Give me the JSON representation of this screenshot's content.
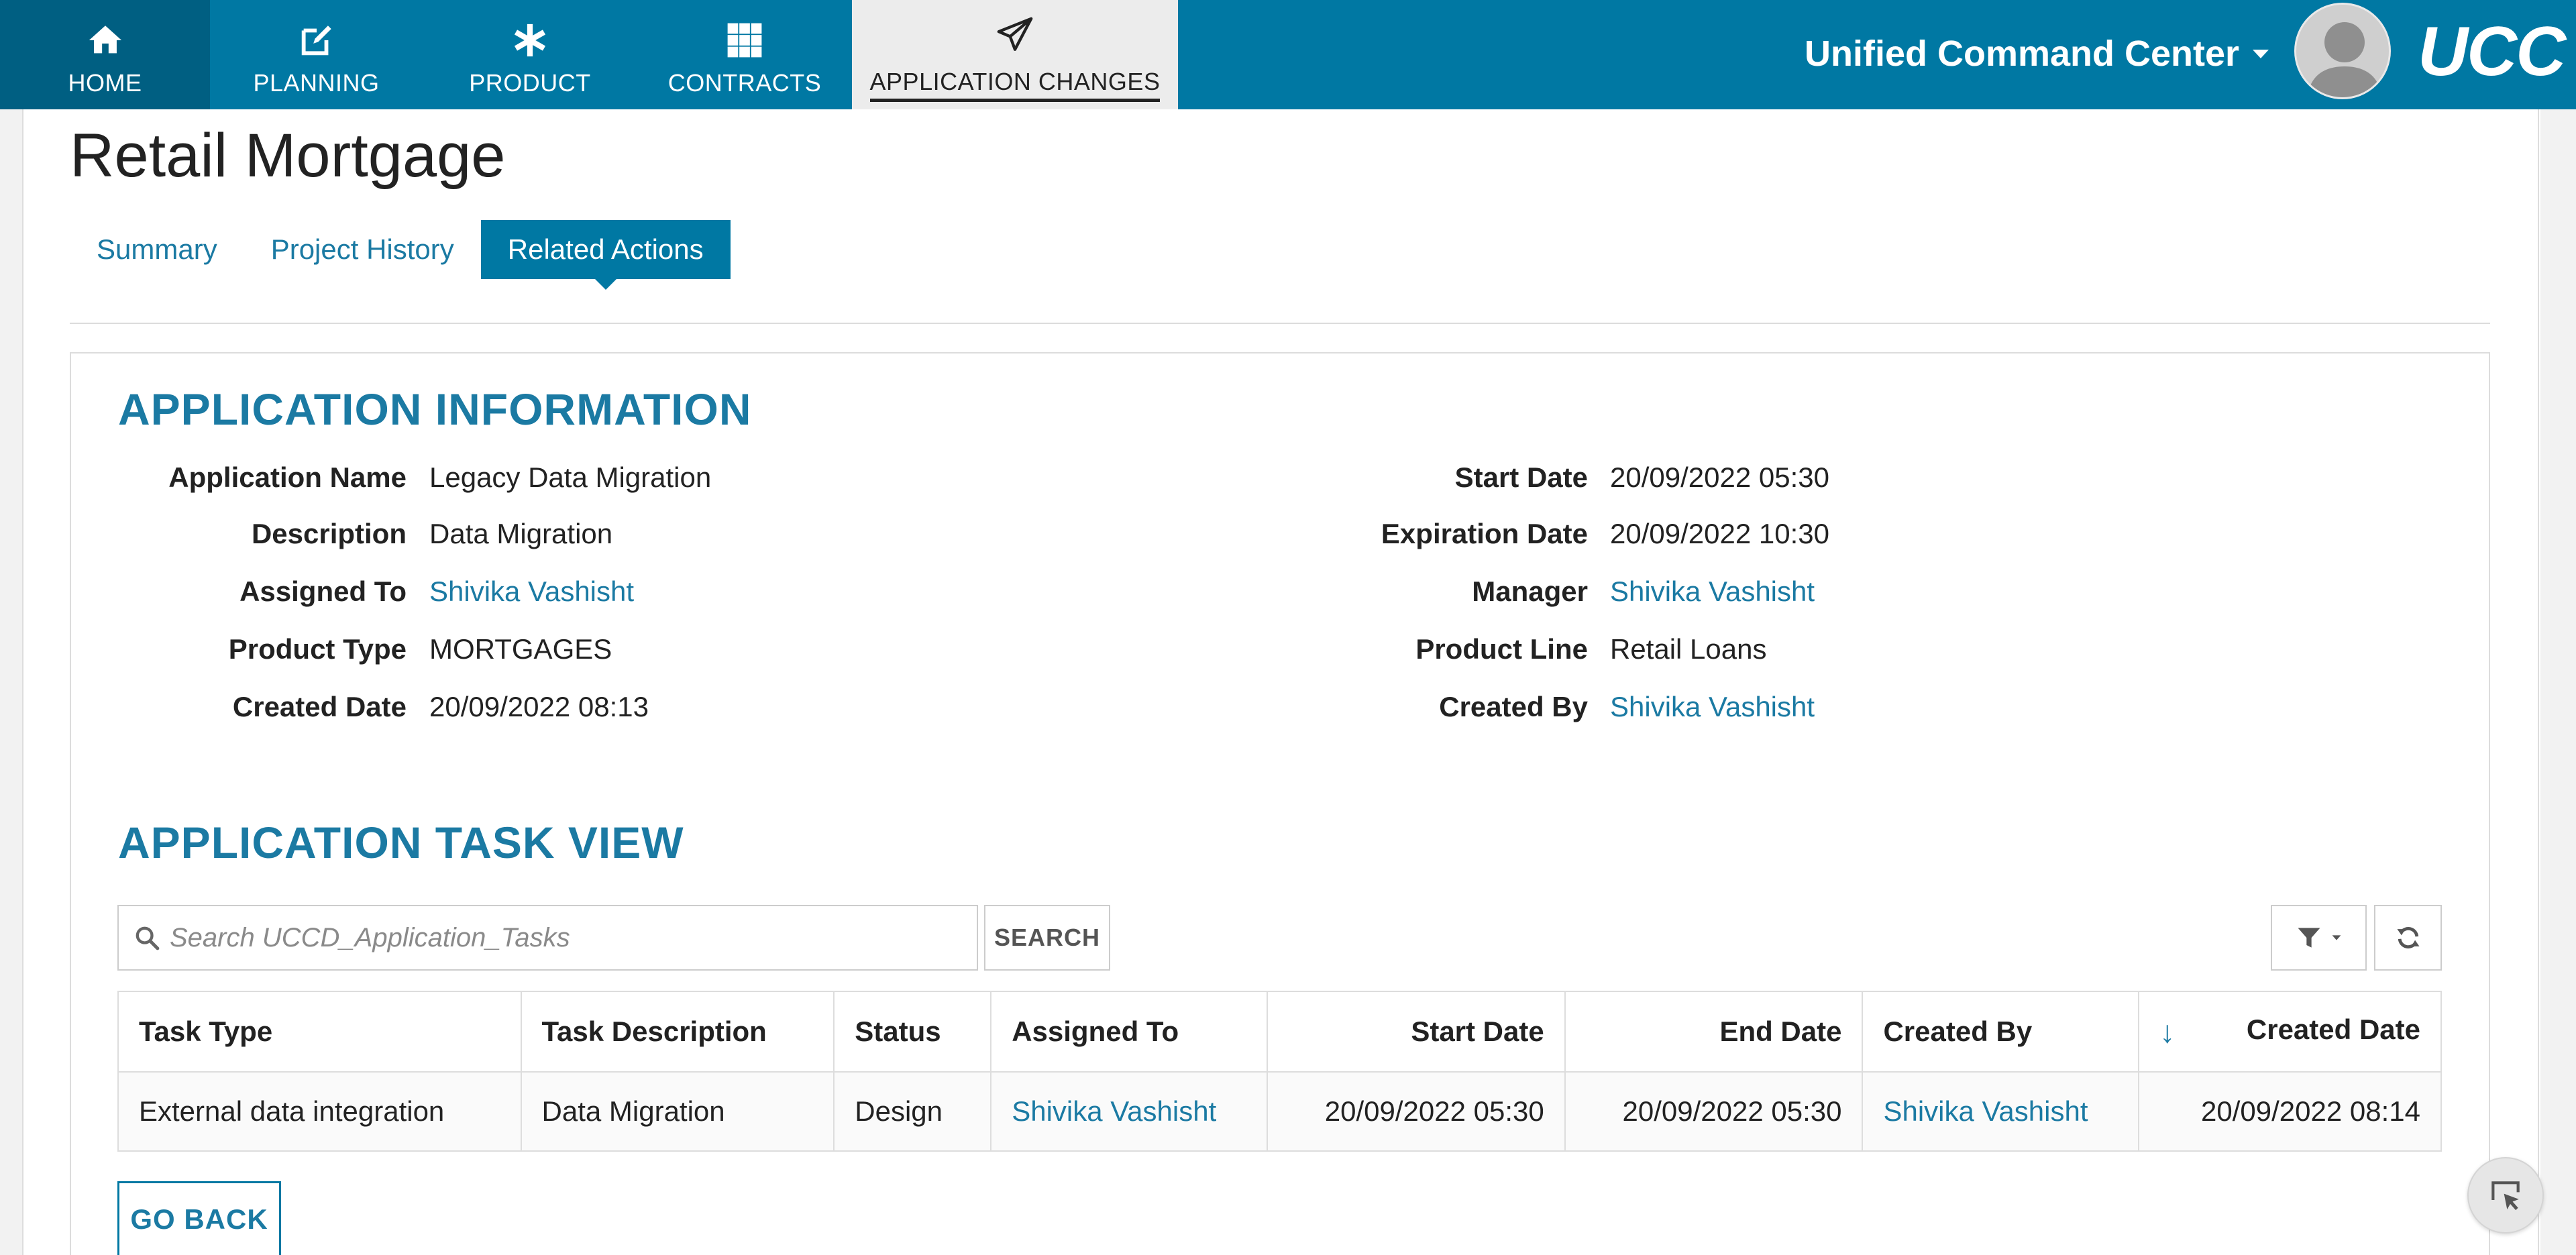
{
  "nav": {
    "items": [
      {
        "label": "HOME",
        "icon": "home-icon"
      },
      {
        "label": "PLANNING",
        "icon": "edit-icon"
      },
      {
        "label": "PRODUCT",
        "icon": "asterisk-icon"
      },
      {
        "label": "CONTRACTS",
        "icon": "grid-icon"
      },
      {
        "label": "APPLICATION CHANGES",
        "icon": "paper-plane-icon",
        "active": true
      }
    ],
    "brand": "Unified Command Center",
    "logo": "UCC"
  },
  "page": {
    "title": "Retail Mortgage",
    "tabs": [
      {
        "label": "Summary"
      },
      {
        "label": "Project History"
      },
      {
        "label": "Related Actions",
        "active": true
      }
    ]
  },
  "app_info": {
    "title": "APPLICATION INFORMATION",
    "left": [
      {
        "label": "Application Name",
        "value": "Legacy Data Migration"
      },
      {
        "label": "Description",
        "value": "Data Migration"
      },
      {
        "label": "Assigned To",
        "value": "Shivika Vashisht",
        "link": true
      },
      {
        "label": "Product Type",
        "value": "MORTGAGES"
      },
      {
        "label": "Created Date",
        "value": "20/09/2022 08:13"
      }
    ],
    "right": [
      {
        "label": "Start Date",
        "value": "20/09/2022 05:30"
      },
      {
        "label": "Expiration Date",
        "value": "20/09/2022 10:30"
      },
      {
        "label": "Manager",
        "value": "Shivika Vashisht",
        "link": true
      },
      {
        "label": "Product Line",
        "value": "Retail Loans"
      },
      {
        "label": "Created By",
        "value": "Shivika Vashisht",
        "link": true
      }
    ]
  },
  "task_view": {
    "title": "APPLICATION TASK VIEW",
    "search_placeholder": "Search UCCD_Application_Tasks",
    "search_label": "SEARCH",
    "sort_indicator": "↓",
    "columns": [
      "Task Type",
      "Task Description",
      "Status",
      "Assigned To",
      "Start Date",
      "End Date",
      "Created By",
      "Created Date"
    ],
    "rows": [
      [
        "External data integration",
        "Data Migration",
        "Design",
        "Shivika Vashisht",
        "20/09/2022 05:30",
        "20/09/2022 05:30",
        "Shivika Vashisht",
        "20/09/2022 08:14"
      ]
    ]
  },
  "go_back_label": "GO BACK",
  "colors": {
    "nav_bg": "#0078a3",
    "nav_active_bg": "#005f82",
    "accent": "#1b7aa3"
  }
}
